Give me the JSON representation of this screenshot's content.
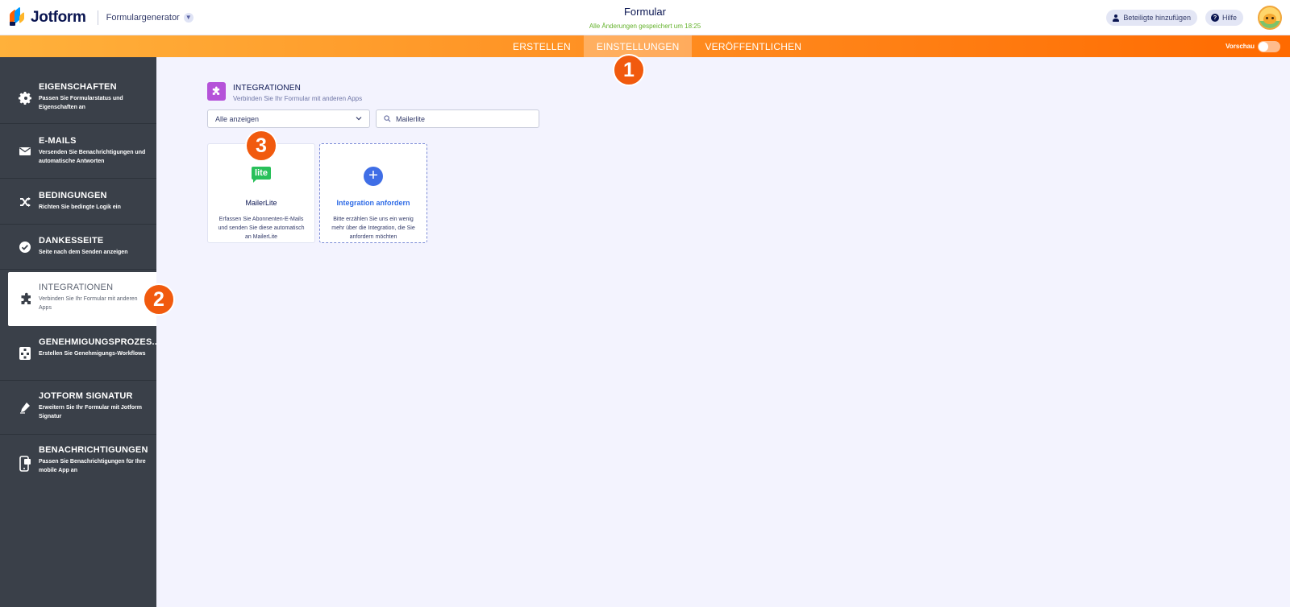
{
  "app": {
    "logo_text": "Jotform",
    "builder_label": "Formulargenerator"
  },
  "header": {
    "form_title": "Formular",
    "save_status": "Alle Änderungen gespeichert um 18:25",
    "add_participants_label": "Beteiligte hinzufügen",
    "help_label": "Hilfe"
  },
  "tabs": [
    {
      "label": "ERSTELLEN",
      "active": false
    },
    {
      "label": "EINSTELLUNGEN",
      "active": true
    },
    {
      "label": "VERÖFFENTLICHEN",
      "active": false
    }
  ],
  "preview_label": "Vorschau",
  "sidebar": {
    "items": [
      {
        "title": "EIGENSCHAFTEN",
        "desc": "Passen Sie Formularstatus und Eigenschaften an",
        "icon": "gear-icon"
      },
      {
        "title": "E-MAILS",
        "desc": "Versenden Sie Benachrichtigungen und automatische Antworten",
        "icon": "envelope-icon"
      },
      {
        "title": "BEDINGUNGEN",
        "desc": "Richten Sie bedingte Logik ein",
        "icon": "shuffle-icon"
      },
      {
        "title": "DANKESSEITE",
        "desc": "Seite nach dem Senden anzeigen",
        "icon": "check-circle-icon"
      },
      {
        "title": "INTEGRATIONEN",
        "desc": "Verbinden Sie Ihr Formular mit anderen Apps",
        "icon": "puzzle-icon",
        "active": true
      },
      {
        "title": "GENEHMIGUNGSPROZES...",
        "desc": "Erstellen Sie Genehmigungs-Workflows",
        "icon": "workflow-icon"
      },
      {
        "title": "JOTFORM SIGNATUR",
        "desc": "Erweitern Sie Ihr Formular mit Jotform Signatur",
        "icon": "pen-icon"
      },
      {
        "title": "BENACHRICHTIGUNGEN",
        "desc": "Passen Sie Benachrichtigungen für Ihre mobile App an",
        "icon": "mobile-icon"
      }
    ]
  },
  "integrations": {
    "title": "INTEGRATIONEN",
    "subtitle": "Verbinden Sie Ihr Formular mit anderen Apps",
    "filter_value": "Alle anzeigen",
    "search_value": "Mailerlite",
    "cards": [
      {
        "name": "MailerLite",
        "logo_text": "lite",
        "desc": "Erfassen Sie Abonnenten-E-Mails und senden Sie diese automatisch an MailerLite"
      },
      {
        "name": "Integration anfordern",
        "desc": "Bitte erzählen Sie uns ein wenig mehr über die Integration, die Sie anfordern möchten"
      }
    ]
  },
  "callouts": [
    "1",
    "2",
    "3"
  ],
  "colors": {
    "accent_orange": "#ff6a00",
    "sidebar_bg": "#3a4049",
    "integration_badge": "#b552d9",
    "mailerlite_green": "#29c05a",
    "link_blue": "#2e6be6"
  }
}
